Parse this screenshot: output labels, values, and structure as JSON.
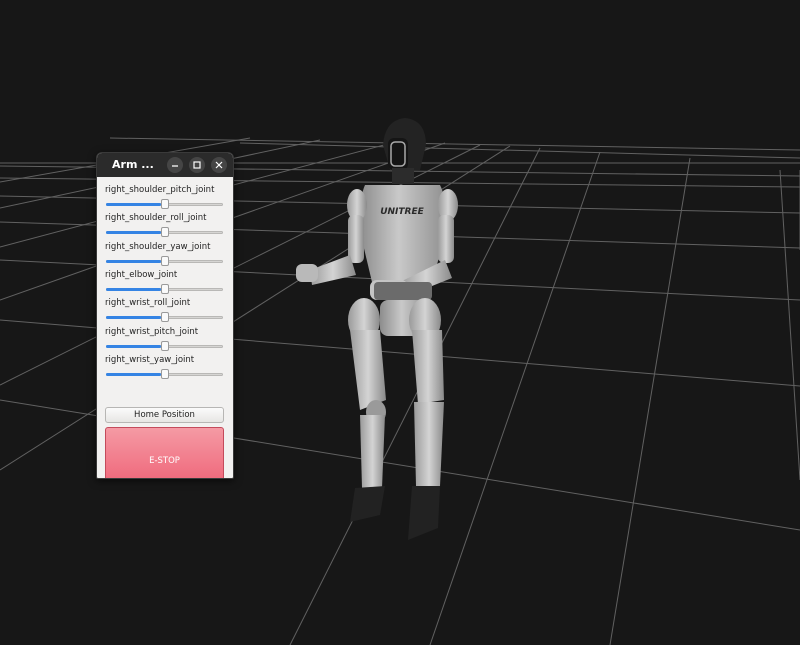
{
  "window": {
    "title": "Arm ...",
    "controls": {
      "minimize_icon": "minimize-icon",
      "maximize_icon": "maximize-icon",
      "close_icon": "close-icon"
    }
  },
  "joints": [
    {
      "label": "right_shoulder_pitch_joint",
      "value": 0.5
    },
    {
      "label": "right_shoulder_roll_joint",
      "value": 0.5
    },
    {
      "label": "right_shoulder_yaw_joint",
      "value": 0.5
    },
    {
      "label": "right_elbow_joint",
      "value": 0.5
    },
    {
      "label": "right_wrist_roll_joint",
      "value": 0.5
    },
    {
      "label": "right_wrist_pitch_joint",
      "value": 0.5
    },
    {
      "label": "right_wrist_yaw_joint",
      "value": 0.5
    }
  ],
  "buttons": {
    "home_label": "Home Position",
    "estop_label": "E-STOP"
  },
  "robot": {
    "chest_logo_text": "UNITREE"
  },
  "colors": {
    "viewport_bg": "#171717",
    "grid_line": "#8a8a8a",
    "slider_accent": "#3584e4",
    "estop": "#ee5e73"
  }
}
